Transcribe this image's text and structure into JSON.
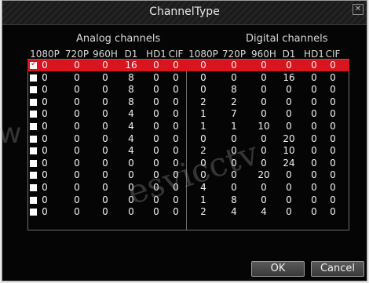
{
  "window": {
    "title": "ChannelType",
    "close_icon": "close-icon"
  },
  "analog": {
    "heading": "Analog channels",
    "columns": [
      "1080P",
      "720P",
      "960H",
      "D1",
      "HD1",
      "CIF"
    ]
  },
  "digital": {
    "heading": "Digital channels",
    "columns": [
      "1080P",
      "720P",
      "960H",
      "D1",
      "HD1",
      "CIF"
    ]
  },
  "rows": [
    {
      "checked": true,
      "analog": [
        "0",
        "0",
        "0",
        "16",
        "0",
        "0"
      ],
      "digital": [
        "0",
        "0",
        "0",
        "0",
        "0",
        "0"
      ]
    },
    {
      "checked": false,
      "analog": [
        "0",
        "0",
        "0",
        "8",
        "0",
        "0"
      ],
      "digital": [
        "0",
        "0",
        "0",
        "16",
        "0",
        "0"
      ]
    },
    {
      "checked": false,
      "analog": [
        "0",
        "0",
        "0",
        "8",
        "0",
        "0"
      ],
      "digital": [
        "0",
        "8",
        "0",
        "0",
        "0",
        "0"
      ]
    },
    {
      "checked": false,
      "analog": [
        "0",
        "0",
        "0",
        "8",
        "0",
        "0"
      ],
      "digital": [
        "2",
        "2",
        "0",
        "0",
        "0",
        "0"
      ]
    },
    {
      "checked": false,
      "analog": [
        "0",
        "0",
        "0",
        "4",
        "0",
        "0"
      ],
      "digital": [
        "1",
        "7",
        "0",
        "0",
        "0",
        "0"
      ]
    },
    {
      "checked": false,
      "analog": [
        "0",
        "0",
        "0",
        "4",
        "0",
        "0"
      ],
      "digital": [
        "1",
        "1",
        "10",
        "0",
        "0",
        "0"
      ]
    },
    {
      "checked": false,
      "analog": [
        "0",
        "0",
        "0",
        "4",
        "0",
        "0"
      ],
      "digital": [
        "0",
        "0",
        "0",
        "20",
        "0",
        "0"
      ]
    },
    {
      "checked": false,
      "analog": [
        "0",
        "0",
        "0",
        "4",
        "0",
        "0"
      ],
      "digital": [
        "2",
        "0",
        "0",
        "10",
        "0",
        "0"
      ]
    },
    {
      "checked": false,
      "analog": [
        "0",
        "0",
        "0",
        "0",
        "0",
        "0"
      ],
      "digital": [
        "0",
        "0",
        "0",
        "24",
        "0",
        "0"
      ]
    },
    {
      "checked": false,
      "analog": [
        "0",
        "0",
        "0",
        "0",
        "0",
        "0"
      ],
      "digital": [
        "0",
        "0",
        "20",
        "0",
        "0",
        "0"
      ]
    },
    {
      "checked": false,
      "analog": [
        "0",
        "0",
        "0",
        "0",
        "0",
        "0"
      ],
      "digital": [
        "4",
        "0",
        "0",
        "0",
        "0",
        "0"
      ]
    },
    {
      "checked": false,
      "analog": [
        "0",
        "0",
        "0",
        "0",
        "0",
        "0"
      ],
      "digital": [
        "1",
        "8",
        "0",
        "0",
        "0",
        "0"
      ]
    },
    {
      "checked": false,
      "analog": [
        "0",
        "0",
        "0",
        "0",
        "0",
        "0"
      ],
      "digital": [
        "2",
        "4",
        "4",
        "0",
        "0",
        "0"
      ]
    }
  ],
  "buttons": {
    "ok": "OK",
    "cancel": "Cancel"
  },
  "watermark": {
    "text": "esvicctv",
    "prefix": "w"
  },
  "colors": {
    "highlight": "#d8141e",
    "background": "#050505",
    "text": "#f2f2f2"
  }
}
